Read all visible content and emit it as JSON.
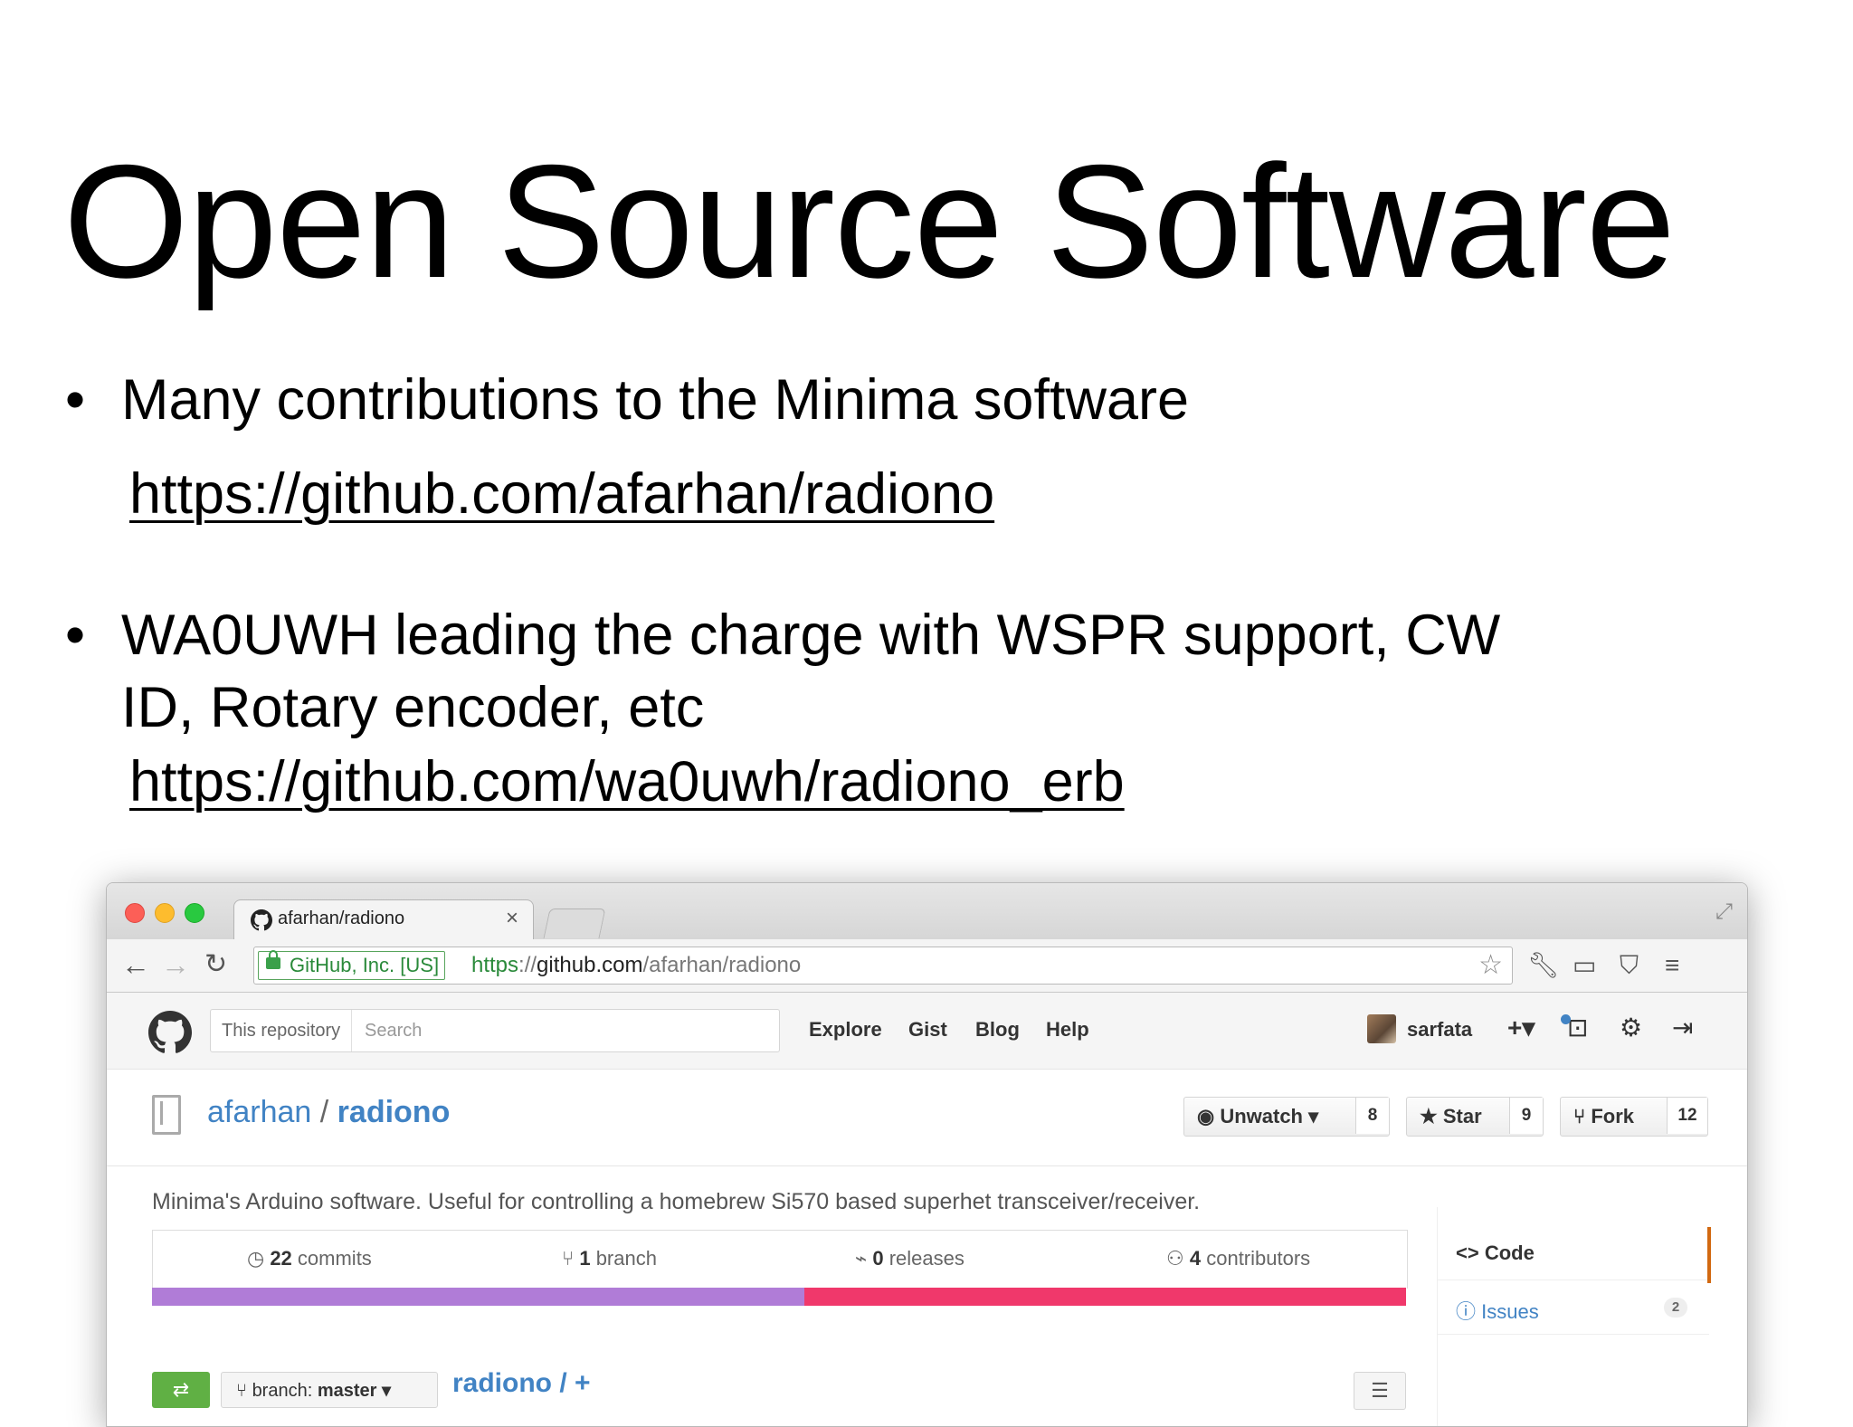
{
  "slide": {
    "title": "Open Source Software",
    "bullet_marker": "•",
    "bullets": [
      {
        "line1": "Many contributions to the Minima software",
        "link": "https://github.com/afarhan/radiono"
      },
      {
        "line1": "WA0UWH leading the charge with WSPR support, CW",
        "line2": "ID, Rotary encoder, etc",
        "link": "https://github.com/wa0uwh/radiono_erb"
      }
    ]
  },
  "browser": {
    "tab_title": "afarhan/radiono",
    "tab_close": "×",
    "ev_badge": "GitHub, Inc. [US]",
    "url_scheme": "https",
    "url_sep": "://",
    "url_host": "github.com",
    "url_path": "/afarhan/radiono",
    "icons": [
      "back-arrow-icon",
      "forward-arrow-icon",
      "reload-icon",
      "lock-icon",
      "star-icon",
      "wrench-icon",
      "cast-icon",
      "pocket-icon",
      "menu-icon",
      "fullscreen-icon"
    ]
  },
  "github": {
    "search_scope": "This repository",
    "search_placeholder": "Search",
    "nav": [
      "Explore",
      "Gist",
      "Blog",
      "Help"
    ],
    "user": "sarfata",
    "plus_label": "+▾",
    "repo_owner": "afarhan",
    "repo_sep": " / ",
    "repo_name": "radiono",
    "unwatch_label": "Unwatch ▾",
    "unwatch_count": "8",
    "star_label": "Star",
    "star_count": "9",
    "fork_label": "Fork",
    "fork_count": "12",
    "description": "Minima's Arduino software. Useful for controlling a homebrew Si570 based superhet transceiver/receiver.",
    "stats": [
      {
        "count": "22",
        "label": "commits"
      },
      {
        "count": "1",
        "label": "branch"
      },
      {
        "count": "0",
        "label": "releases"
      },
      {
        "count": "4",
        "label": "contributors"
      }
    ],
    "languages": [
      {
        "color": "#b07cd7",
        "fraction": 0.52
      },
      {
        "color": "#f0386b",
        "fraction": 0.48
      }
    ],
    "branch_label": "branch:",
    "branch_value": "master ▾",
    "path_crumb": "radiono / +",
    "sidebar": [
      {
        "label": "Code",
        "icon": "code-icon"
      },
      {
        "label": "Issues",
        "icon": "issue-icon",
        "count": "2"
      }
    ]
  }
}
